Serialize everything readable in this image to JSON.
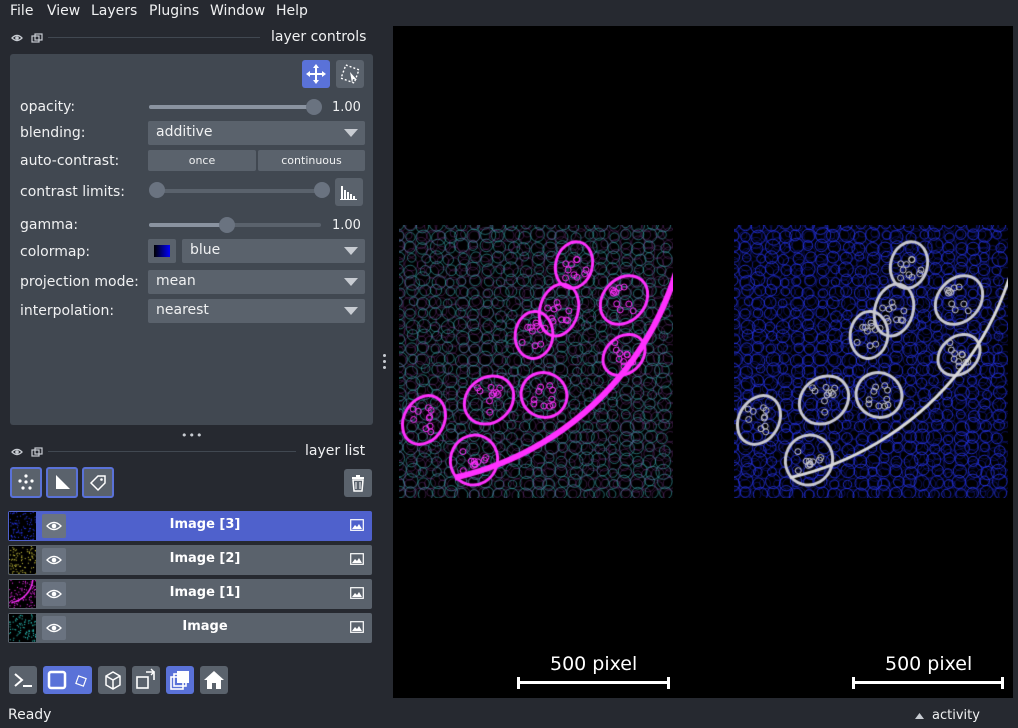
{
  "menu": {
    "items": [
      "File",
      "View",
      "Layers",
      "Plugins",
      "Window",
      "Help"
    ]
  },
  "layer_controls": {
    "title": "layer controls",
    "opacity": {
      "label": "opacity:",
      "value": "1.00",
      "level": 1.0
    },
    "blending": {
      "label": "blending:",
      "value": "additive"
    },
    "auto_contrast": {
      "label": "auto-contrast:",
      "once": "once",
      "continuous": "continuous"
    },
    "contrast_limits": {
      "label": "contrast limits:",
      "low": 0.0,
      "high": 1.0
    },
    "gamma": {
      "label": "gamma:",
      "value": "1.00",
      "level": 0.5
    },
    "colormap": {
      "label": "colormap:",
      "value": "blue"
    },
    "projection_mode": {
      "label": "projection mode:",
      "value": "mean"
    },
    "interpolation": {
      "label": "interpolation:",
      "value": "nearest"
    }
  },
  "layer_list": {
    "title": "layer list",
    "layers": [
      {
        "name": "Image [3]",
        "selected": true,
        "color": "#2a3aff"
      },
      {
        "name": "Image [2]",
        "selected": false,
        "color": "#d8d040"
      },
      {
        "name": "Image [1]",
        "selected": false,
        "color": "#ff30ff"
      },
      {
        "name": "Image",
        "selected": false,
        "color": "#30d8d0"
      }
    ]
  },
  "canvas": {
    "scale_bar_left": "500 pixel",
    "scale_bar_right": "500 pixel"
  },
  "status": {
    "text": "Ready",
    "activity": "activity"
  },
  "colors": {
    "accent": "#5a72d8",
    "panel": "#414851",
    "background": "#262930"
  }
}
